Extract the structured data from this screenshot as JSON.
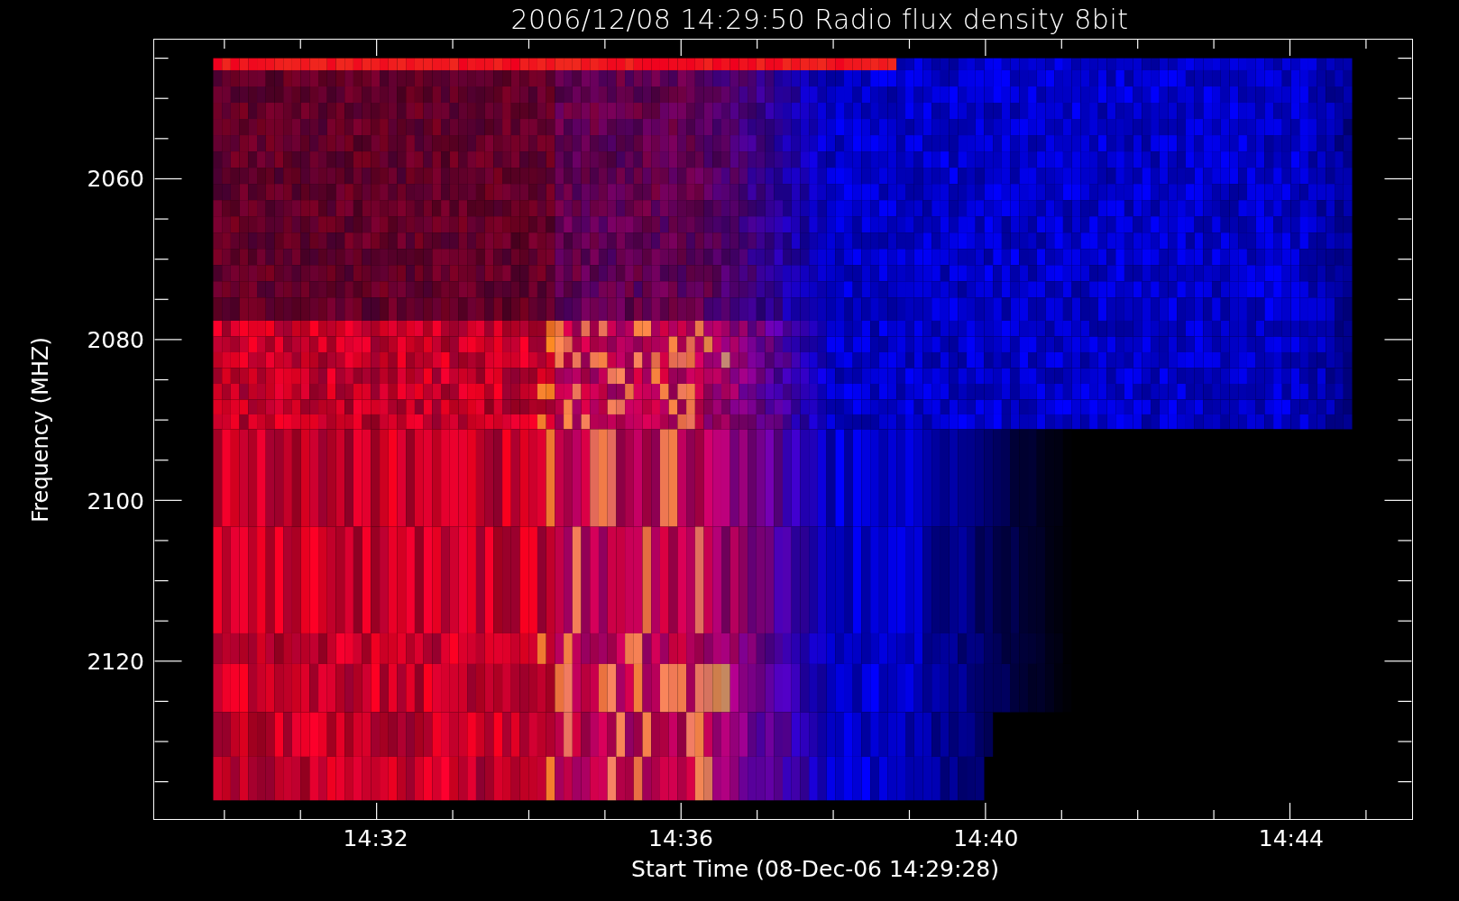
{
  "title": "2006/12/08 14:29:50 Radio flux density 8bit",
  "y_axis": {
    "label": "Frequency (MHZ)",
    "ticks": [
      "2060",
      "2080",
      "2100",
      "2120"
    ]
  },
  "x_axis": {
    "label": "Start Time (08-Dec-06 14:29:28)",
    "ticks": [
      "14:32",
      "14:36",
      "14:40",
      "14:44"
    ]
  }
}
